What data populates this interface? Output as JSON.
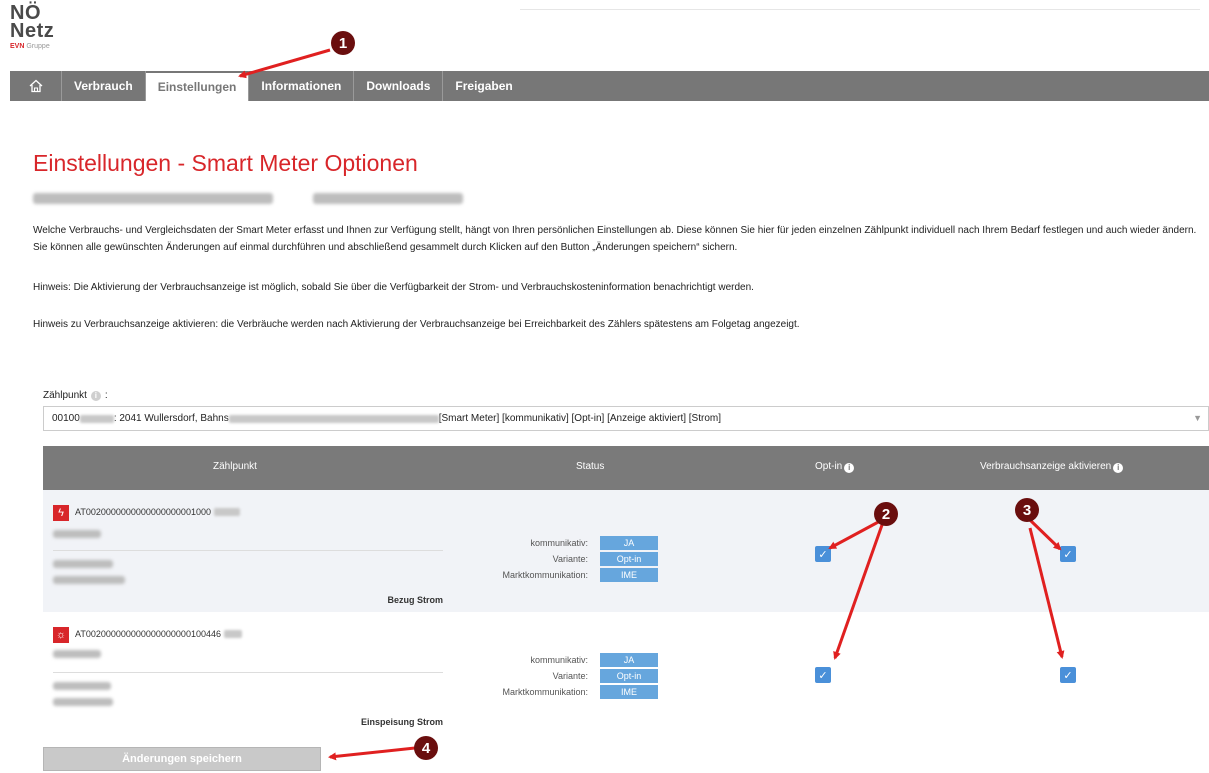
{
  "logo": {
    "line1": "NÖ",
    "line2": "Netz",
    "brand": "EVN",
    "group": "Gruppe"
  },
  "nav": {
    "home_icon": "home-icon",
    "tabs": [
      {
        "label": "Verbrauch",
        "active": false
      },
      {
        "label": "Einstellungen",
        "active": true
      },
      {
        "label": "Informationen",
        "active": false
      },
      {
        "label": "Downloads",
        "active": false
      },
      {
        "label": "Freigaben",
        "active": false
      }
    ]
  },
  "page": {
    "title": "Einstellungen - Smart Meter Optionen",
    "description": "Welche Verbrauchs- und Vergleichsdaten der Smart Meter erfasst und Ihnen zur Verfügung stellt, hängt von Ihren persönlichen Einstellungen ab. Diese können Sie hier für jeden einzelnen Zählpunkt individuell nach Ihrem Bedarf festlegen und auch wieder ändern. Sie können alle gewünschten Änderungen auf einmal durchführen und abschließend gesammelt durch Klicken auf den Button „Änderungen speichern“ sichern.",
    "hint1": "Hinweis: Die Aktivierung der Verbrauchsanzeige ist möglich, sobald Sie über die Verfügbarkeit der Strom- und Verbrauchskosteninformation benachrichtigt werden.",
    "hint2": "Hinweis zu Verbrauchsanzeige aktivieren: die Verbräuche werden nach Aktivierung der Verbrauchsanzeige bei Erreichbarkeit des Zählers spätestens am Folgetag angezeigt."
  },
  "selector": {
    "label": "Zählpunkt",
    "value_prefix": "00100",
    "value_mid": ": 2041 Wullersdorf, Bahns",
    "value_suffix": "[Smart Meter] [kommunikativ] [Opt-in] [Anzeige aktiviert] [Strom]"
  },
  "table": {
    "headers": {
      "zaehlpunkt": "Zählpunkt",
      "status": "Status",
      "optin": "Opt-in",
      "anzeige": "Verbrauchsanzeige aktivieren"
    },
    "status_labels": {
      "kommunikativ": "kommunikativ:",
      "variante": "Variante:",
      "markt": "Marktkommunikation:"
    },
    "rows": [
      {
        "id": "AT0020000000000000000001000",
        "kommunikativ": "JA",
        "variante": "Opt-in",
        "markt": "IME",
        "type": "Bezug Strom",
        "optin": true,
        "anzeige": true
      },
      {
        "id": "AT002000000000000000000100446",
        "kommunikativ": "JA",
        "variante": "Opt-in",
        "markt": "IME",
        "type": "Einspeisung Strom",
        "optin": true,
        "anzeige": true
      }
    ]
  },
  "save_button": "Änderungen speichern",
  "annotations": [
    "1",
    "2",
    "3",
    "4"
  ],
  "colors": {
    "brand_red": "#d8262a",
    "nav_gray": "#777777",
    "badge_blue": "#66a6dd",
    "checkbox_blue": "#4a90d9",
    "marker": "#6a0e0e",
    "arrow": "#e02020"
  }
}
